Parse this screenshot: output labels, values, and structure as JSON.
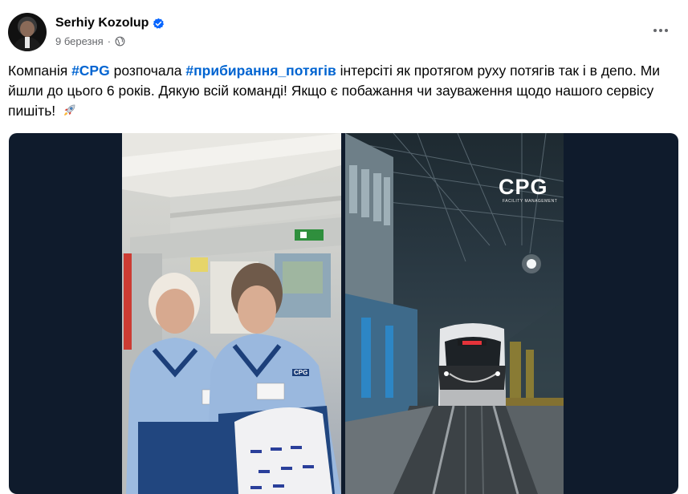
{
  "post": {
    "author": "Serhiy Kozolup",
    "date": "9 березня",
    "separator": "·",
    "text": {
      "part1": "Компанія ",
      "hashtag1": "#CPG",
      "part2": " розпочала ",
      "hashtag2": "#прибирання_потягів",
      "part3": " інтерсіті як протягом руху потягів так і в депо. Ми йшли до цього 6 років. Дякую всій команді! Якщо є побажання чи зауваження щодо нашого сервісу пишіть!"
    }
  },
  "media": {
    "logo_text": "CPG",
    "logo_subtext": "FACILITY MANAGEMENT",
    "badge_text": "CPG"
  },
  "icons": {
    "verified": "verified-badge-icon",
    "audience": "globe-icon",
    "more": "more-options-icon",
    "emoji": "rocket-icon"
  },
  "colors": {
    "hashtag": "#0064d1",
    "verified": "#0866ff",
    "meta_text": "#65676b",
    "media_background": "#0f1b2c"
  }
}
